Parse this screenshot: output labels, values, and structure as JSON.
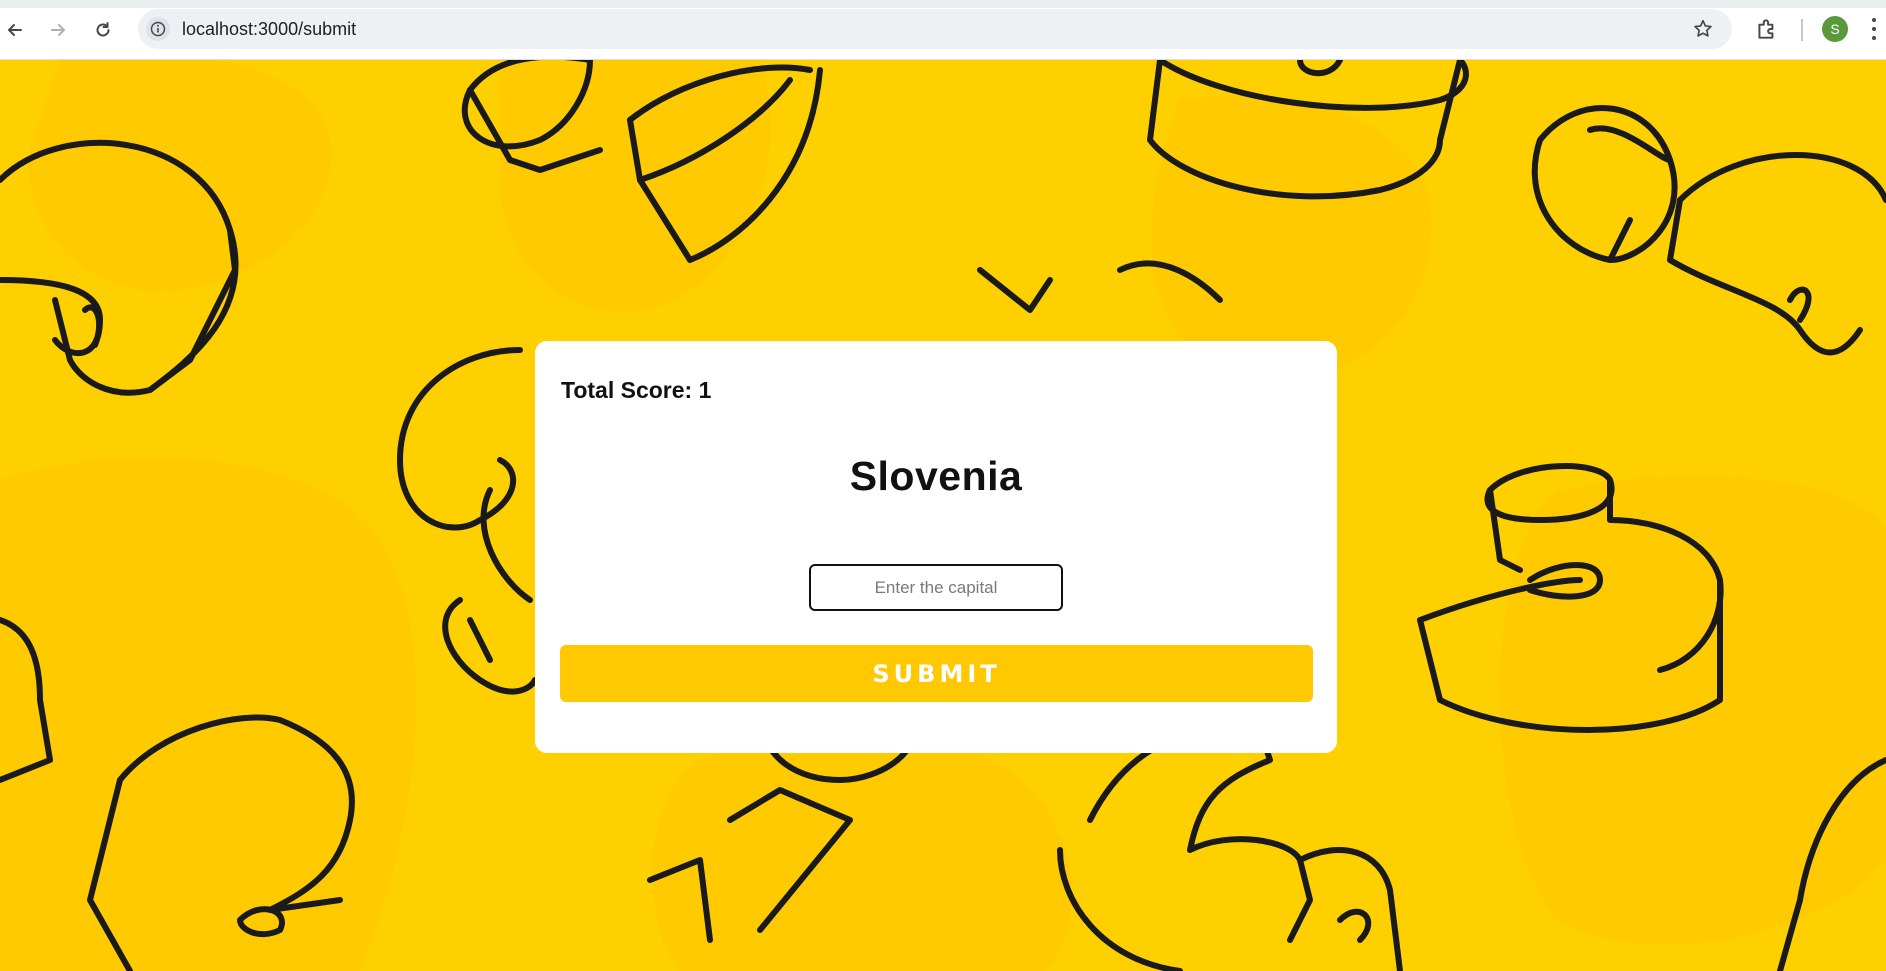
{
  "browser": {
    "url": "localhost:3000/submit",
    "profile_initial": "S",
    "icons": [
      "back-arrow-icon",
      "forward-arrow-icon",
      "reload-icon",
      "site-info-icon",
      "bookmark-star-icon",
      "extensions-puzzle-icon",
      "kebab-menu-icon"
    ]
  },
  "game": {
    "score_text": "Total Score: 1",
    "country": "Slovenia",
    "input": {
      "value": "",
      "placeholder": "Enter the capital"
    },
    "submit_label": "SUBMIT"
  },
  "colors": {
    "page_background": "#ffd000",
    "submit_button": "#ffc800",
    "card": "#ffffff",
    "outline_art": "#1a1a1a"
  }
}
